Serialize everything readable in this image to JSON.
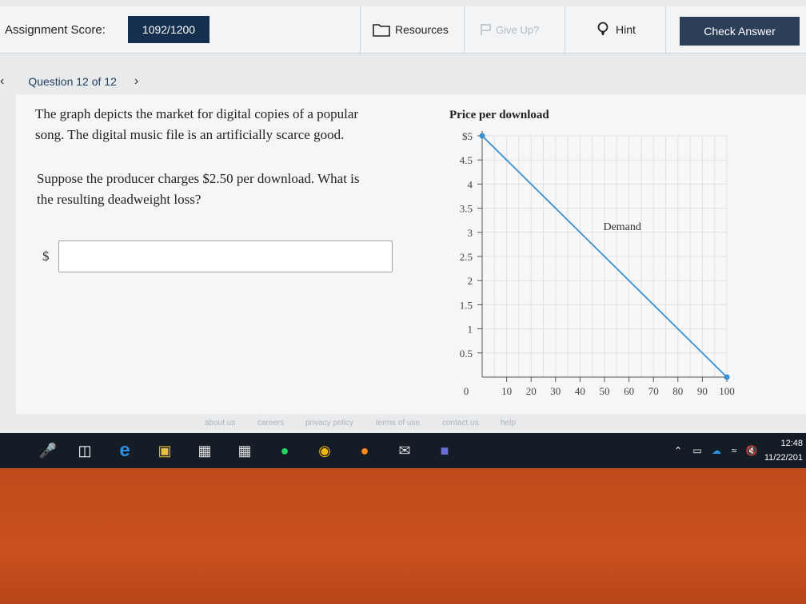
{
  "header": {
    "score_label": "Assignment Score:",
    "score_value": "1092/1200",
    "resources_label": "Resources",
    "giveup_label": "Give Up?",
    "hint_label": "Hint",
    "check_answer_label": "Check Answer"
  },
  "question_nav": {
    "label": "Question 12 of 12"
  },
  "question": {
    "p1_line1": "The graph depicts the market for digital copies of a popular",
    "p1_line2": "song. The digital music file is an artificially scarce good.",
    "p2_line1": "Suppose the producer charges $2.50 per download. What is",
    "p2_line2": "the resulting deadweight loss?",
    "currency_symbol": "$",
    "answer_value": ""
  },
  "chart_data": {
    "type": "line",
    "ylabel": "Price per download",
    "y_ticks": [
      "$5",
      "4.5",
      "4",
      "3.5",
      "3",
      "2.5",
      "2",
      "1.5",
      "1",
      "0.5"
    ],
    "y_tick_values": [
      5,
      4.5,
      4,
      3.5,
      3,
      2.5,
      2,
      1.5,
      1,
      0.5
    ],
    "x_ticks": [
      "0",
      "10",
      "20",
      "30",
      "40",
      "50",
      "60",
      "70",
      "80",
      "90",
      "100"
    ],
    "x_tick_values": [
      0,
      10,
      20,
      30,
      40,
      50,
      60,
      70,
      80,
      90,
      100
    ],
    "xlim": [
      0,
      100
    ],
    "ylim": [
      0,
      5
    ],
    "grid": true,
    "series": [
      {
        "name": "Demand",
        "x": [
          0,
          100
        ],
        "y": [
          5,
          0
        ],
        "color": "#3a8fd1"
      }
    ]
  },
  "footer": {
    "links": [
      "about us",
      "careers",
      "privacy policy",
      "terms of use",
      "contact us",
      "help"
    ]
  },
  "taskbar": {
    "time": "12:48",
    "date": "11/22/201"
  },
  "colors": {
    "score_bg": "#15304f",
    "check_btn_bg": "#2b3f58",
    "demand_line": "#3a8fd1",
    "taskbar_bg": "#141c26"
  }
}
